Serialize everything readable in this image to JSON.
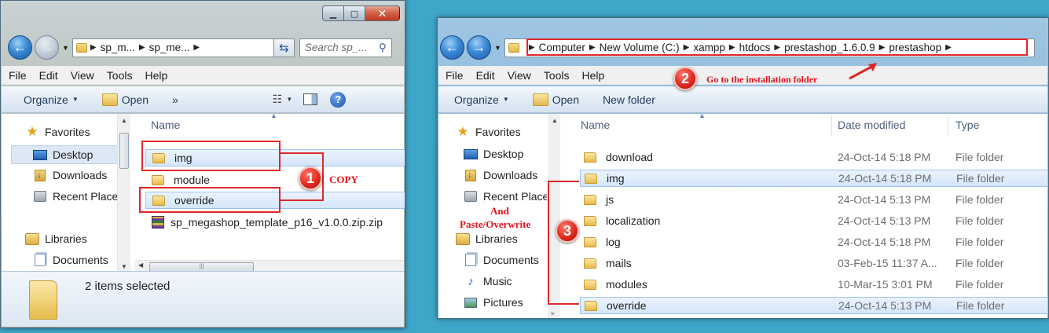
{
  "window1": {
    "address_segments": [
      "sp_m...",
      "sp_me..."
    ],
    "search_placeholder": "Search sp_...",
    "menu": [
      "File",
      "Edit",
      "View",
      "Tools",
      "Help"
    ],
    "toolbar": {
      "organize": "Organize",
      "open": "Open",
      "more": "»"
    },
    "nav": [
      {
        "label": "Favorites",
        "icon": "star-icon"
      },
      {
        "label": "Desktop",
        "icon": "desktop-icon"
      },
      {
        "label": "Downloads",
        "icon": "downloads-folder-icon"
      },
      {
        "label": "Recent Places",
        "icon": "recent-places-icon"
      },
      {
        "label": "Libraries",
        "icon": "libraries-icon"
      },
      {
        "label": "Documents",
        "icon": "documents-icon"
      }
    ],
    "column_name": "Name",
    "files": [
      {
        "name": "img",
        "selected": true,
        "kind": "folder"
      },
      {
        "name": "module",
        "selected": false,
        "kind": "folder"
      },
      {
        "name": "override",
        "selected": true,
        "kind": "folder"
      },
      {
        "name": "sp_megashop_template_p16_v1.0.0.zip.zip",
        "selected": false,
        "kind": "zip"
      }
    ],
    "status": "2 items selected"
  },
  "window2": {
    "address_segments": [
      "Computer",
      "New Volume (C:)",
      "xampp",
      "htdocs",
      "prestashop_1.6.0.9",
      "prestashop"
    ],
    "menu": [
      "File",
      "Edit",
      "View",
      "Tools",
      "Help"
    ],
    "toolbar": {
      "organize": "Organize",
      "open": "Open",
      "new_folder": "New folder"
    },
    "nav": [
      {
        "label": "Favorites",
        "icon": "star-icon"
      },
      {
        "label": "Desktop",
        "icon": "desktop-icon"
      },
      {
        "label": "Downloads",
        "icon": "downloads-folder-icon"
      },
      {
        "label": "Recent Places",
        "icon": "recent-places-icon"
      },
      {
        "label": "Libraries",
        "icon": "libraries-icon"
      },
      {
        "label": "Documents",
        "icon": "documents-icon"
      },
      {
        "label": "Music",
        "icon": "music-icon"
      },
      {
        "label": "Pictures",
        "icon": "pictures-icon"
      }
    ],
    "columns": {
      "name": "Name",
      "date": "Date modified",
      "type": "Type"
    },
    "files": [
      {
        "name": "download",
        "date": "24-Oct-14 5:18 PM",
        "type": "File folder",
        "selected": false
      },
      {
        "name": "img",
        "date": "24-Oct-14 5:18 PM",
        "type": "File folder",
        "selected": true
      },
      {
        "name": "js",
        "date": "24-Oct-14 5:13 PM",
        "type": "File folder",
        "selected": false
      },
      {
        "name": "localization",
        "date": "24-Oct-14 5:13 PM",
        "type": "File folder",
        "selected": false
      },
      {
        "name": "log",
        "date": "24-Oct-14 5:18 PM",
        "type": "File folder",
        "selected": false
      },
      {
        "name": "mails",
        "date": "03-Feb-15 11:37 A...",
        "type": "File folder",
        "selected": false
      },
      {
        "name": "modules",
        "date": "10-Mar-15 3:01 PM",
        "type": "File folder",
        "selected": false
      },
      {
        "name": "override",
        "date": "24-Oct-14 5:13 PM",
        "type": "File folder",
        "selected": true
      }
    ]
  },
  "annotations": {
    "step1": {
      "number": "1",
      "text": "COPY"
    },
    "step2": {
      "number": "2",
      "text": "Go to the installation folder"
    },
    "step3": {
      "number": "3",
      "text_line1": "And",
      "text_line2": "Paste/Overwrite"
    }
  },
  "colors": {
    "annotation_red": "#e0282c",
    "desktop_bg": "#3ea6c9",
    "selection_bg": "#d4e6fb"
  }
}
